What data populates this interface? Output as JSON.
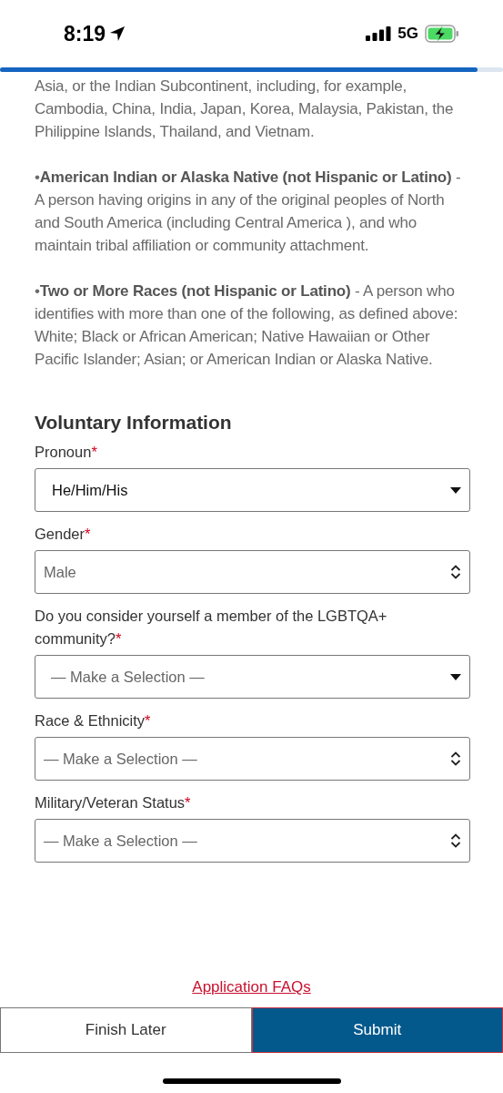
{
  "status_bar": {
    "time": "8:19",
    "network": "5G"
  },
  "progress": {
    "level": 0.95
  },
  "paragraphs": [
    "Asia, or the Indian Subcontinent, including, for example, Cambodia, China, India, Japan, Korea, Malaysia, Pakistan, the Philippine Islands, Thailand, and Vietnam.",
    "•**American Indian or Alaska Native (not Hispanic or Latino)** - A person having origins in any of the original peoples of North and South America (including Central America ), and who maintain tribal affiliation or community attachment.",
    "•**Two or More Races (not Hispanic or Latino)** - A person who identifies with more than one of the following, as defined above: White; Black or African American; Native Hawaiian or Other Pacific Islander; Asian; or American Indian or Alaska Native."
  ],
  "section": {
    "title": "Voluntary Information",
    "fields": [
      {
        "label": "Pronoun",
        "required_mark": "*",
        "value": "He/Him/His",
        "kind": "dropdown",
        "filled": true
      },
      {
        "label": "Gender",
        "required_mark": "*",
        "value": "Male",
        "kind": "select",
        "filled": false
      },
      {
        "label": "Do you consider yourself a member of the LGBTQA+ community?",
        "required_mark": "*",
        "value": "— Make a Selection —",
        "kind": "dropdown",
        "filled": false
      },
      {
        "label": "Race & Ethnicity",
        "required_mark": "*",
        "value": "— Make a Selection —",
        "kind": "select",
        "filled": false
      },
      {
        "label": "Military/Veteran Status",
        "required_mark": "*",
        "value": "— Make a Selection —",
        "kind": "select",
        "filled": false
      }
    ]
  },
  "footer": {
    "link": "Application FAQs",
    "buttons": [
      {
        "label": "Finish Later",
        "kind": "secondary"
      },
      {
        "label": "Submit",
        "kind": "primary"
      }
    ]
  }
}
